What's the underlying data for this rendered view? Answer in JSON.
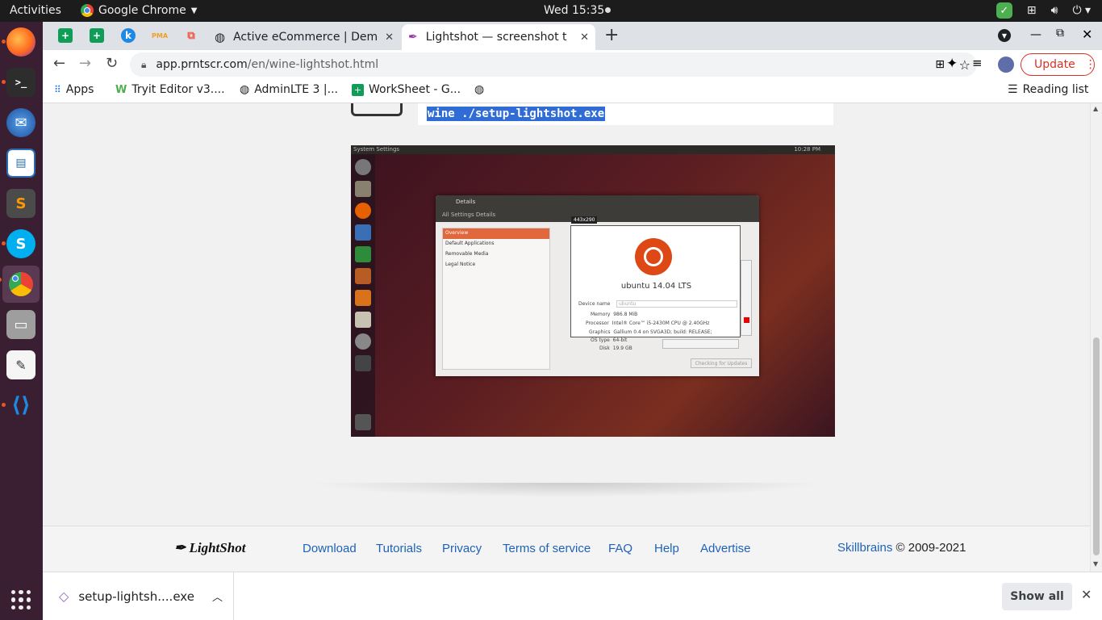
{
  "topbar": {
    "activities": "Activities",
    "app_name": "Google Chrome",
    "clock": "Wed 15:35"
  },
  "dock": {
    "items": [
      "firefox-icon",
      "terminal-icon",
      "thunderbird-icon",
      "libreoffice-impress-icon",
      "sublime-text-icon",
      "skype-icon",
      "chrome-icon",
      "files-icon",
      "text-editor-icon",
      "vscode-icon",
      "show-applications-icon"
    ]
  },
  "tabs": {
    "items": [
      {
        "label": "Active eCommerce | Demo"
      },
      {
        "label": "Lightshot — screenshot t"
      }
    ],
    "new_tab": "+"
  },
  "toolbar": {
    "url_host": "app.prntscr.com",
    "url_path": "/en/wine-lightshot.html",
    "update_label": "Update"
  },
  "bookmarks": {
    "apps": "Apps",
    "items": [
      "Tryit Editor v3....",
      "AdminLTE 3 |...",
      "WorkSheet - G..."
    ],
    "reading_list": "Reading list"
  },
  "page": {
    "command": "wine ./setup-lightshot.exe",
    "screenshot": {
      "system_settings": "System Settings",
      "time": "10:28 PM",
      "dialog_title": "Details",
      "breadcrumb": "All Settings   Details",
      "side_items": [
        "Overview",
        "Default Applications",
        "Removable Media",
        "Legal Notice"
      ],
      "size_label": "443x290",
      "os_title": "ubuntu 14.04 LTS",
      "device_name_label": "Device name",
      "device_name_value": "ubuntu",
      "memory_label": "Memory",
      "memory_value": "986.8 MiB",
      "processor_label": "Processor",
      "processor_value": "Intel® Core™ i5-2430M CPU @ 2.40GHz",
      "graphics_label": "Graphics",
      "graphics_value": "Gallium 0.4 on SVGA3D; build: RELEASE;",
      "ostype_label": "OS type",
      "ostype_value": "64-bit",
      "disk_label": "Disk",
      "disk_value": "19.9 GB",
      "check_updates": "Checking for Updates"
    }
  },
  "footer": {
    "brand": "LightShot",
    "links": [
      "Download",
      "Tutorials",
      "Privacy",
      "Terms of service",
      "FAQ",
      "Help",
      "Advertise"
    ],
    "company": "Skillbrains",
    "copyright": " © 2009-2021"
  },
  "downloads": {
    "file": "setup-lightsh....exe",
    "show_all": "Show all"
  },
  "colors": {
    "accent": "#e95420",
    "link": "#1e62b8",
    "update": "#d93025"
  }
}
